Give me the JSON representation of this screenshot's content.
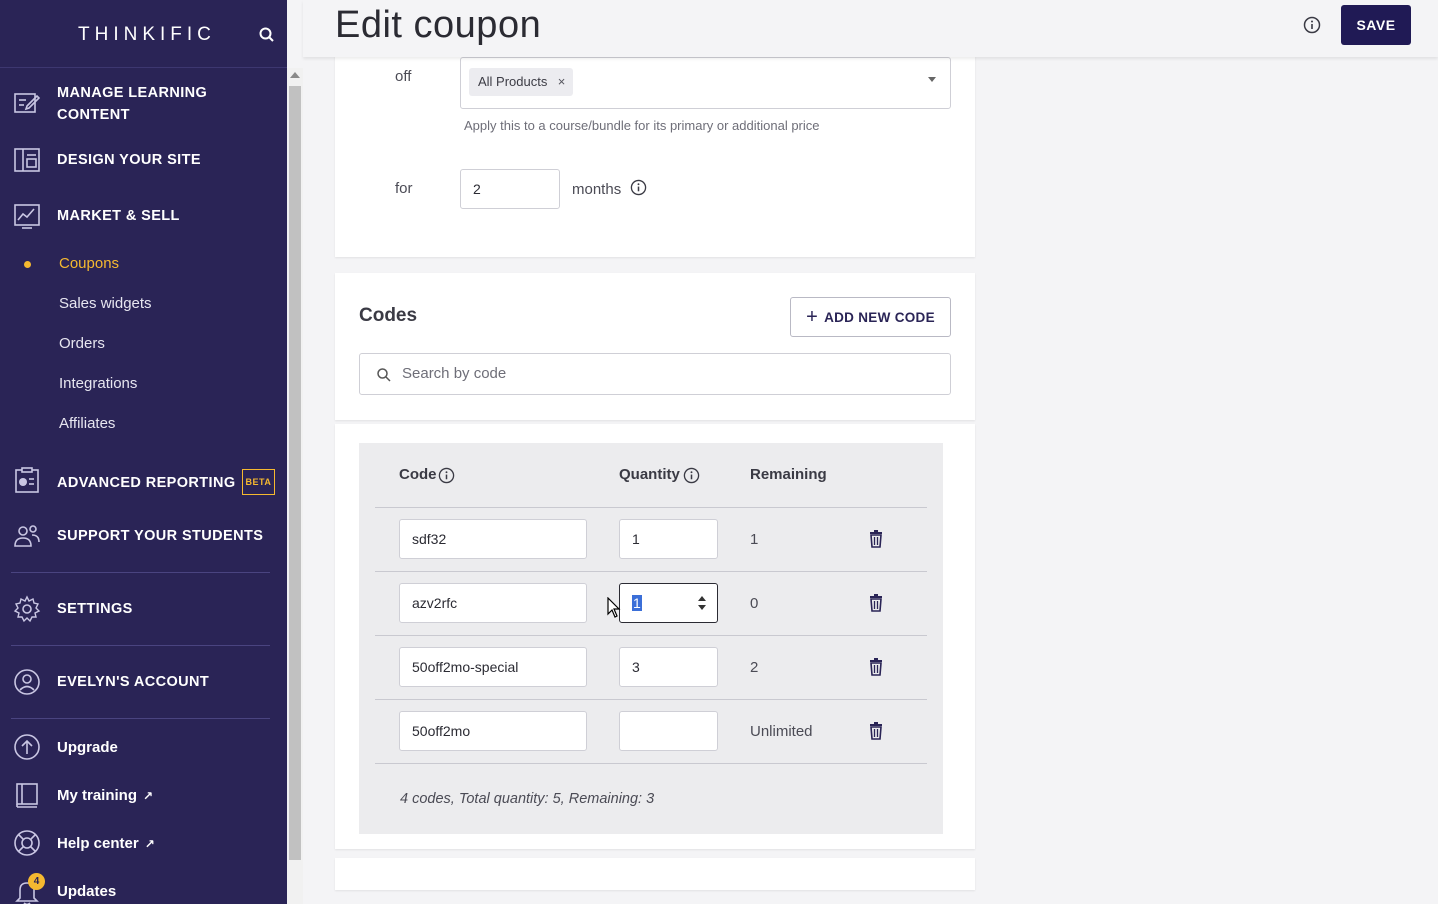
{
  "sidebar": {
    "logo": "THINKIFIC",
    "main_items": [
      {
        "label": "MANAGE LEARNING CONTENT",
        "icon": "edit-content-icon"
      },
      {
        "label": "DESIGN YOUR SITE",
        "icon": "layout-icon"
      },
      {
        "label": "MARKET & SELL",
        "icon": "chart-icon"
      }
    ],
    "sub_items": [
      {
        "label": "Coupons",
        "active": true
      },
      {
        "label": "Sales widgets"
      },
      {
        "label": "Orders"
      },
      {
        "label": "Integrations"
      },
      {
        "label": "Affiliates"
      }
    ],
    "reporting": {
      "label": "ADVANCED REPORTING",
      "badge": "BETA"
    },
    "support": {
      "label": "SUPPORT YOUR STUDENTS"
    },
    "settings": {
      "label": "SETTINGS"
    },
    "account": {
      "label": "EVELYN'S ACCOUNT"
    },
    "bottom": [
      {
        "label": "Upgrade"
      },
      {
        "label": "My training",
        "external": "↗"
      },
      {
        "label": "Help center",
        "external": "↗"
      },
      {
        "label": "Updates",
        "badge": "4"
      }
    ]
  },
  "header": {
    "title": "Edit coupon",
    "save_label": "SAVE"
  },
  "discount": {
    "off_label": "off",
    "product_chip": "All Products",
    "chip_remove": "×",
    "hint": "Apply this to a course/bundle for its primary or additional price",
    "for_label": "for",
    "duration_value": "2",
    "duration_unit": "months"
  },
  "codes": {
    "title": "Codes",
    "add_label": "ADD NEW CODE",
    "add_icon": "+",
    "search_placeholder": "Search by code",
    "columns": {
      "code": "Code",
      "quantity": "Quantity",
      "remaining": "Remaining"
    },
    "rows": [
      {
        "code": "sdf32",
        "quantity": "1",
        "remaining": "1"
      },
      {
        "code": "azv2rfc",
        "quantity": "1",
        "remaining": "0"
      },
      {
        "code": "50off2mo-special",
        "quantity": "3",
        "remaining": "2"
      },
      {
        "code": "50off2mo",
        "quantity": "",
        "remaining": "Unlimited"
      }
    ],
    "summary": "4 codes, Total quantity: 5, Remaining: 3"
  },
  "colors": {
    "sidebar_bg": "#2a2456",
    "accent": "#f5b930",
    "primary_button": "#201a55"
  }
}
